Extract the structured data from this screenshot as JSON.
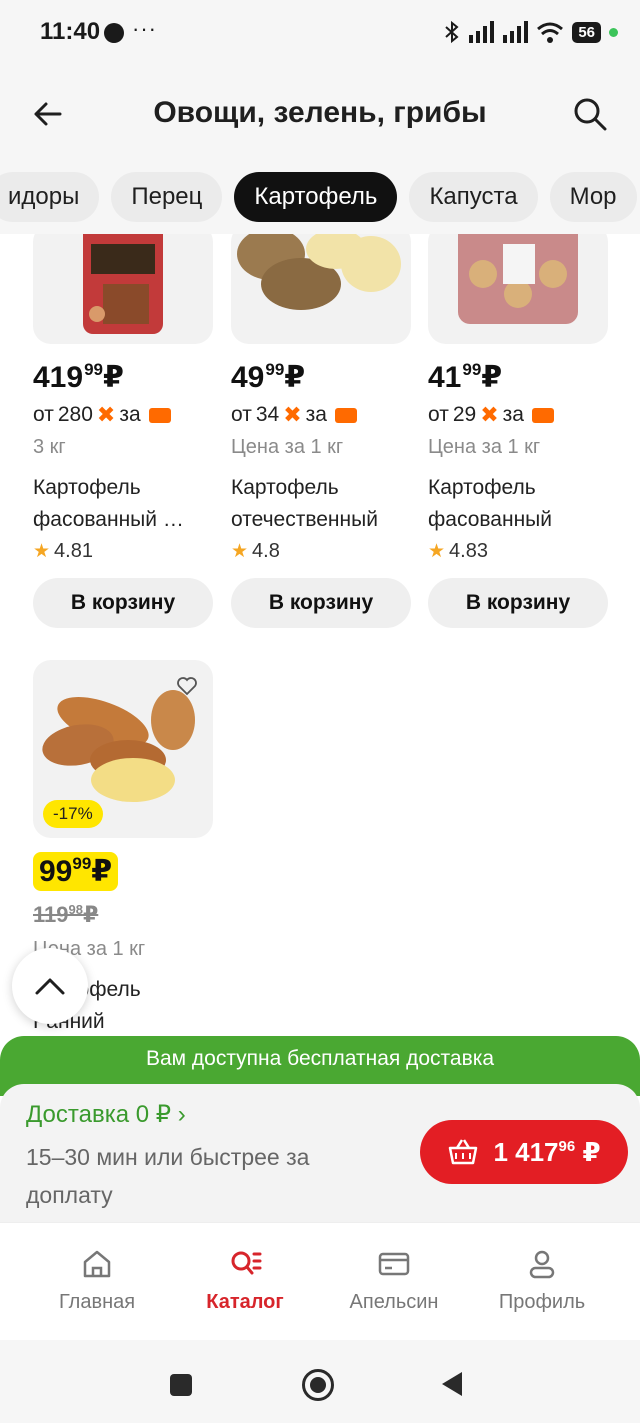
{
  "status_bar": {
    "time": "11:40",
    "dots": "···",
    "battery": "56"
  },
  "header": {
    "title": "Овощи, зелень, грибы"
  },
  "chips": [
    "идоры",
    "Перец",
    "Картофель",
    "Капуста",
    "Мор"
  ],
  "active_chip": "Картофель",
  "products": [
    {
      "price_main": "419",
      "price_kop": "99",
      "currency": "₽",
      "from_prefix": "от",
      "from_price": "280",
      "from_suffix": "за",
      "unit": "3 кг",
      "name": "Картофель фасованный …",
      "rating": "4.81",
      "cart_label": "В корзину"
    },
    {
      "price_main": "49",
      "price_kop": "99",
      "currency": "₽",
      "from_prefix": "от",
      "from_price": "34",
      "from_suffix": "за",
      "unit": "Цена за 1 кг",
      "name": "Картофель отечественный",
      "rating": "4.8",
      "cart_label": "В корзину"
    },
    {
      "price_main": "41",
      "price_kop": "99",
      "currency": "₽",
      "from_prefix": "от",
      "from_price": "29",
      "from_suffix": "за",
      "unit": "Цена за 1 кг",
      "name": "Картофель фасованный",
      "rating": "4.83",
      "cart_label": "В корзину"
    },
    {
      "discount": "-17%",
      "price_main": "99",
      "price_kop": "99",
      "currency": "₽",
      "old_price_main": "119",
      "old_price_kop": "98",
      "old_currency": "₽",
      "unit": "Цена за 1 кг",
      "name": "Картофель Ранний"
    }
  ],
  "promo": {
    "text": "Вам доступна бесплатная доставка"
  },
  "delivery": {
    "title": "Доставка 0 ₽ ›",
    "subtitle": "15–30 мин или быстрее за доплату",
    "cart_total_main": "1 417",
    "cart_total_kop": "96",
    "cart_currency": "₽"
  },
  "nav": {
    "items": [
      {
        "label": "Главная",
        "icon": "home-icon"
      },
      {
        "label": "Каталог",
        "icon": "catalog-search-icon"
      },
      {
        "label": "Апельсин",
        "icon": "card-icon"
      },
      {
        "label": "Профиль",
        "icon": "profile-icon"
      }
    ],
    "active": "Каталог",
    "accent": "#d7252b"
  },
  "colors": {
    "accent_red": "#e31e24",
    "promo_green": "#4aa832",
    "discount_yellow": "#ffe600",
    "orange": "#ff6a00"
  }
}
